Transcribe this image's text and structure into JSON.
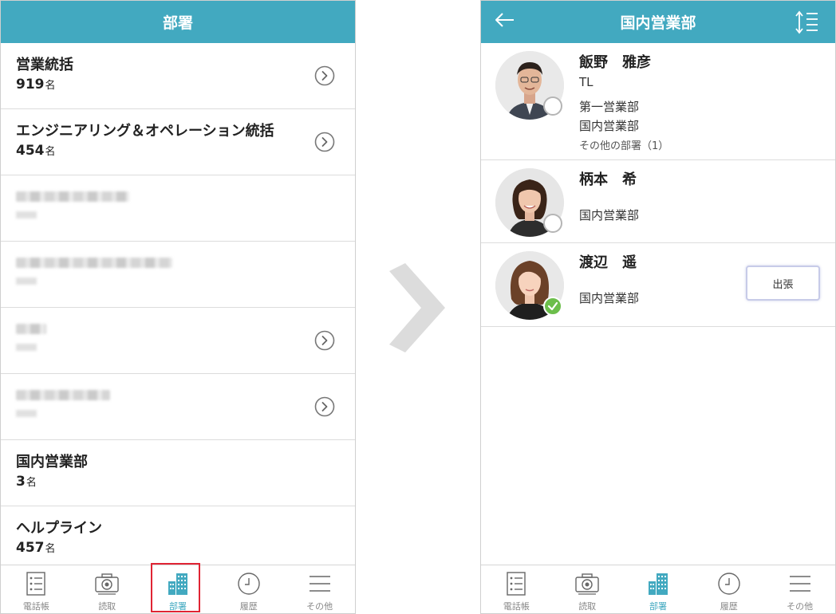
{
  "left": {
    "header_title": "部署",
    "departments": [
      {
        "name": "営業統括",
        "count": "919",
        "unit": "名",
        "has_chevron": true,
        "blurred": false
      },
      {
        "name": "エンジニアリング＆オペレーション統括",
        "count": "454",
        "unit": "名",
        "has_chevron": true,
        "blurred": false
      },
      {
        "name": "",
        "count": "",
        "unit": "",
        "has_chevron": false,
        "blurred": true
      },
      {
        "name": "",
        "count": "",
        "unit": "",
        "has_chevron": false,
        "blurred": true
      },
      {
        "name": "",
        "count": "",
        "unit": "",
        "has_chevron": true,
        "blurred": true
      },
      {
        "name": "",
        "count": "",
        "unit": "",
        "has_chevron": true,
        "blurred": true
      },
      {
        "name": "国内営業部",
        "count": "3",
        "unit": "名",
        "has_chevron": false,
        "blurred": false
      },
      {
        "name": "ヘルプライン",
        "count": "457",
        "unit": "名",
        "has_chevron": false,
        "blurred": false
      }
    ]
  },
  "right": {
    "header_title": "国内営業部",
    "members": [
      {
        "name": "飯野　雅彦",
        "title": "TL",
        "lines": [
          "第一営業部",
          "国内営業部"
        ],
        "extra": "その他の部署（1）",
        "status": "off",
        "badge": ""
      },
      {
        "name": "柄本　希",
        "title": "",
        "lines": [
          "国内営業部"
        ],
        "extra": "",
        "status": "off",
        "badge": ""
      },
      {
        "name": "渡辺　遥",
        "title": "",
        "lines": [
          "国内営業部"
        ],
        "extra": "",
        "status": "on",
        "badge": "出張"
      }
    ]
  },
  "tabs": [
    {
      "label": "電話帳",
      "icon": "phonebook-icon"
    },
    {
      "label": "読取",
      "icon": "camera-icon"
    },
    {
      "label": "部署",
      "icon": "building-icon"
    },
    {
      "label": "履歴",
      "icon": "clock-icon"
    },
    {
      "label": "その他",
      "icon": "menu-icon"
    }
  ],
  "active_tab": 2,
  "colors": {
    "header": "#42a9c0",
    "active": "#42a9c0",
    "inactive": "#888888",
    "highlight": "#e02434",
    "online": "#6cbe4b"
  }
}
